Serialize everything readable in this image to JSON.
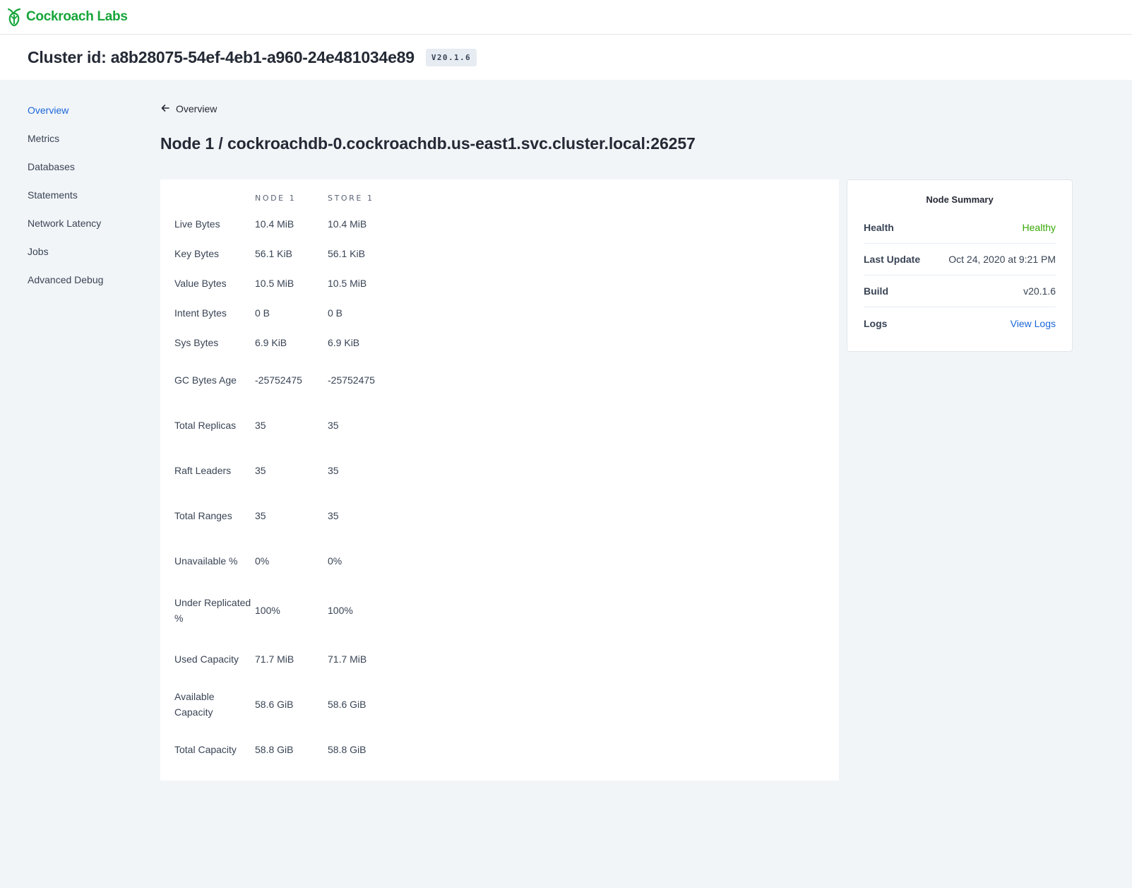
{
  "brand": {
    "name": "Cockroach Labs",
    "color": "#17a53a"
  },
  "cluster": {
    "title": "Cluster id: a8b28075-54ef-4eb1-a960-24e481034e89",
    "version": "V20.1.6"
  },
  "sidebar": {
    "items": [
      {
        "label": "Overview",
        "active": true
      },
      {
        "label": "Metrics"
      },
      {
        "label": "Databases"
      },
      {
        "label": "Statements"
      },
      {
        "label": "Network Latency"
      },
      {
        "label": "Jobs"
      },
      {
        "label": "Advanced Debug"
      }
    ]
  },
  "breadcrumb": {
    "icon": "arrow-left-icon",
    "label": "Overview"
  },
  "page": {
    "title": "Node 1 / cockroachdb-0.cockroachdb.us-east1.svc.cluster.local:26257"
  },
  "metrics": {
    "columns": [
      "",
      "NODE 1",
      "STORE 1"
    ],
    "rows": [
      {
        "label": "Live Bytes",
        "node": "10.4 MiB",
        "store": "10.4 MiB"
      },
      {
        "label": "Key Bytes",
        "node": "56.1 KiB",
        "store": "56.1 KiB"
      },
      {
        "label": "Value Bytes",
        "node": "10.5 MiB",
        "store": "10.5 MiB"
      },
      {
        "label": "Intent Bytes",
        "node": "0 B",
        "store": "0 B"
      },
      {
        "label": "Sys Bytes",
        "node": "6.9 KiB",
        "store": "6.9 KiB"
      },
      {
        "label": "GC Bytes Age",
        "node": "-25752475",
        "store": "-25752475"
      },
      {
        "label": "Total Replicas",
        "node": "35",
        "store": "35"
      },
      {
        "label": "Raft Leaders",
        "node": "35",
        "store": "35"
      },
      {
        "label": "Total Ranges",
        "node": "35",
        "store": "35"
      },
      {
        "label": "Unavailable %",
        "node": "0%",
        "store": "0%"
      },
      {
        "label": "Under Replicated %",
        "node": "100%",
        "store": "100%"
      },
      {
        "label": "Used Capacity",
        "node": "71.7 MiB",
        "store": "71.7 MiB"
      },
      {
        "label": "Available Capacity",
        "node": "58.6 GiB",
        "store": "58.6 GiB"
      },
      {
        "label": "Total Capacity",
        "node": "58.8 GiB",
        "store": "58.8 GiB"
      }
    ]
  },
  "summary": {
    "title": "Node Summary",
    "health_label": "Health",
    "health_value": "Healthy",
    "health_color": "#37a806",
    "last_update_label": "Last Update",
    "last_update_value": "Oct 24, 2020 at 9:21 PM",
    "build_label": "Build",
    "build_value": "v20.1.6",
    "logs_label": "Logs",
    "logs_link": "View Logs"
  }
}
